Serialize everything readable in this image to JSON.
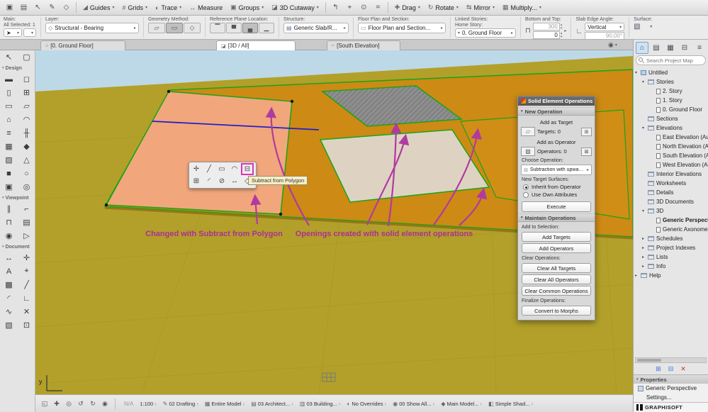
{
  "colors": {
    "selection_green": "#17a517",
    "annotation_magenta": "#ad2f92",
    "ground_olive": "#b2a02a",
    "slab_orange": "#cd8a14",
    "slab_peach": "#f2a67c",
    "sky_blue": "#bdd9e7"
  },
  "menubar": {
    "left_icons": [
      "new-window",
      "tile-windows",
      "select-arrow",
      "pencil",
      "snap-guides"
    ],
    "mid_icons": [
      "back",
      "origin",
      "snap-point",
      "snap-grid"
    ],
    "guides": "Guides",
    "grids": "Grids",
    "trace": "Trace",
    "measure": "Measure",
    "groups": "Groups",
    "cutaway": "3D Cutaway",
    "drag": "Drag",
    "rotate": "Rotate",
    "mirror": "Mirror",
    "multiply": "Multiply..."
  },
  "infobar": {
    "main": "Main:",
    "all_selected": "All Selected: 1",
    "layer_label": "Layer:",
    "layer_value": "Structural - Bearing",
    "geometry_label": "Geometry Method:",
    "refplane_label": "Reference Plane Location:",
    "structure_label": "Structure:",
    "structure_value": "Generic Slab/R...",
    "fps_label": "Floor Plan and Section:",
    "fps_value": "Floor Plan and Section...",
    "linked_label": "Linked Stories:",
    "home_story_label": "Home Story:",
    "home_story_value": "0. Ground Floor",
    "bottom_top_label": "Bottom and Top:",
    "bottom_value": "300",
    "top_value": "0",
    "edge_label": "Slab Edge Angle:",
    "edge_value": "Vertical",
    "edge_angle": "90,00°",
    "surface_label": "Surface:"
  },
  "tabs": {
    "ground_floor": "[0. Ground Floor]",
    "three_d": "[3D / All]",
    "south_elevation": "[South Elevation]"
  },
  "tools": {
    "design_header": "Design",
    "viewpoint_header": "Viewpoint",
    "document_header": "Document",
    "selection": [
      "arrow",
      "marquee"
    ],
    "design": [
      "wall",
      "door",
      "column",
      "window",
      "beam",
      "slab",
      "roof",
      "shell",
      "stair",
      "railing",
      "curtain-wall",
      "morph",
      "zone",
      "mesh",
      "object",
      "lamp",
      "equipment",
      "opening"
    ],
    "viewpoint": [
      "section",
      "elevation",
      "interior-elevation",
      "worksheet",
      "detail",
      "camera"
    ],
    "document": [
      "dimension",
      "level-dimension",
      "text",
      "label",
      "fill",
      "line",
      "arc",
      "polyline",
      "spline",
      "hotspot",
      "figure",
      "drawing"
    ]
  },
  "viewport": {
    "annotation_subtract": "Changed with Subtract from Polygon",
    "annotation_openings": "Openings created with solid element operations",
    "tooltip": "Subtract from Polygon",
    "axis_label": "y",
    "pet_icons": [
      "move-node",
      "offset-edge",
      "offset-all-edges",
      "curve-edge",
      "subtract-from-polygon",
      "add-to-polygon",
      "fillet",
      "intersect",
      "stretch",
      "bulge"
    ]
  },
  "seo": {
    "title": "Solid Element Operations",
    "new_operation": "New Operation",
    "add_as_target": "Add as Target",
    "targets": "Targets: 0",
    "add_as_operator": "Add as Operator",
    "operators": "Operators: 0",
    "choose_operation": "Choose Operation:",
    "operation": "Subtraction with upward...",
    "new_target_surfaces": "New Target Surfaces:",
    "inherit_from_operator": "Inherit from Operator",
    "use_own_attributes": "Use Own Attributes",
    "execute": "Execute",
    "maintain_operations": "Maintain Operations",
    "add_to_selection": "Add to Selection:",
    "add_targets": "Add Targets",
    "add_operators": "Add Operators",
    "clear_operations": "Clear Operations:",
    "clear_all_targets": "Clear All Targets",
    "clear_all_operators": "Clear All Operators",
    "clear_common_operations": "Clear Common Operations",
    "finalize_operations": "Finalize Operations:",
    "convert_to_morphs": "Convert to Morphs"
  },
  "navigator": {
    "top_icons": [
      "project-map",
      "view-map",
      "layout-book",
      "publisher"
    ],
    "search_placeholder": "Search Project Map",
    "tree": [
      {
        "label": "Untitled",
        "level": 0,
        "disc": "open",
        "icon": "home",
        "bold": false
      },
      {
        "label": "Stories",
        "level": 1,
        "disc": "open",
        "icon": "folder",
        "bold": false
      },
      {
        "label": "2. Story",
        "level": 2,
        "disc": "",
        "icon": "page",
        "bold": false
      },
      {
        "label": "1. Story",
        "level": 2,
        "disc": "",
        "icon": "page",
        "bold": false
      },
      {
        "label": "0. Ground Floor",
        "level": 2,
        "disc": "",
        "icon": "page",
        "bold": false
      },
      {
        "label": "Sections",
        "level": 1,
        "disc": "",
        "icon": "folder",
        "bold": false
      },
      {
        "label": "Elevations",
        "level": 1,
        "disc": "open",
        "icon": "folder",
        "bold": false
      },
      {
        "label": "East Elevation (Auto...",
        "level": 2,
        "disc": "",
        "icon": "page",
        "bold": false
      },
      {
        "label": "North Elevation (Au...",
        "level": 2,
        "disc": "",
        "icon": "page",
        "bold": false
      },
      {
        "label": "South Elevation (Au...",
        "level": 2,
        "disc": "",
        "icon": "page",
        "bold": false
      },
      {
        "label": "West Elevation (Aut...",
        "level": 2,
        "disc": "",
        "icon": "page",
        "bold": false
      },
      {
        "label": "Interior Elevations",
        "level": 1,
        "disc": "",
        "icon": "folder",
        "bold": false
      },
      {
        "label": "Worksheets",
        "level": 1,
        "disc": "",
        "icon": "folder",
        "bold": false
      },
      {
        "label": "Details",
        "level": 1,
        "disc": "",
        "icon": "folder",
        "bold": false
      },
      {
        "label": "3D Documents",
        "level": 1,
        "disc": "",
        "icon": "folder",
        "bold": false
      },
      {
        "label": "3D",
        "level": 1,
        "disc": "open",
        "icon": "folder",
        "bold": false
      },
      {
        "label": "Generic Perspective",
        "level": 2,
        "disc": "",
        "icon": "page",
        "bold": true
      },
      {
        "label": "Generic Axonometry",
        "level": 2,
        "disc": "",
        "icon": "page",
        "bold": false
      },
      {
        "label": "Schedules",
        "level": 1,
        "disc": "closed",
        "icon": "folder",
        "bold": false
      },
      {
        "label": "Project Indexes",
        "level": 1,
        "disc": "closed",
        "icon": "folder",
        "bold": false
      },
      {
        "label": "Lists",
        "level": 1,
        "disc": "closed",
        "icon": "folder",
        "bold": false
      },
      {
        "label": "Info",
        "level": 1,
        "disc": "closed",
        "icon": "folder",
        "bold": false
      },
      {
        "label": "Help",
        "level": 0,
        "disc": "closed",
        "icon": "folder",
        "bold": false
      }
    ],
    "properties_header": "Properties",
    "properties_item": "Generic Perspective",
    "settings": "Settings...",
    "brand": "GRAPHISOFT"
  },
  "statusbar": {
    "icons": [
      "fit",
      "pan",
      "zoom",
      "orbit",
      "explore",
      "look"
    ],
    "na": "N/A",
    "items": [
      {
        "icon": "",
        "label": "1:100"
      },
      {
        "icon": "✎",
        "label": "02 Drafting"
      },
      {
        "icon": "▦",
        "label": "Entire Model"
      },
      {
        "icon": "▤",
        "label": "03 Architect..."
      },
      {
        "icon": "▥",
        "label": "03 Building..."
      },
      {
        "icon": "◐",
        "label": "No Overrides"
      },
      {
        "icon": "◉",
        "label": "00 Show All..."
      },
      {
        "icon": "◆",
        "label": "Main Model..."
      },
      {
        "icon": "◧",
        "label": "Simple Shad..."
      }
    ]
  }
}
